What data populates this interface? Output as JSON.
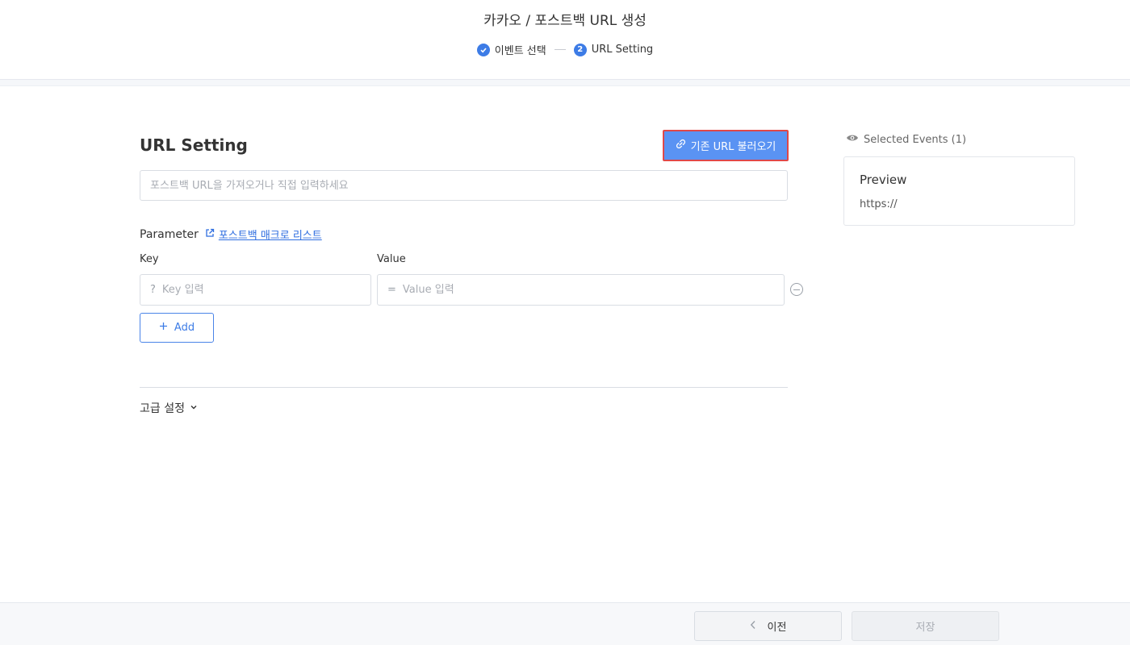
{
  "header": {
    "title": "카카오 / 포스트백 URL 생성",
    "steps": [
      {
        "label": "이벤트 선택",
        "state": "done"
      },
      {
        "number": "2",
        "label": "URL Setting",
        "state": "current"
      }
    ]
  },
  "main": {
    "title": "URL Setting",
    "load_button": "기존 URL 불러오기",
    "url_placeholder": "포스트백 URL을 가져오거나 직접 입력하세요",
    "parameter_label": "Parameter",
    "macro_link": "포스트백 매크로 리스트",
    "key_label": "Key",
    "value_label": "Value",
    "key_prefix": "?",
    "value_prefix": "=",
    "key_placeholder": "Key 입력",
    "value_placeholder": "Value 입력",
    "add_button": "Add",
    "advanced": "고급 설정"
  },
  "side": {
    "selected_events": "Selected Events (1)",
    "preview_title": "Preview",
    "preview_url": "https://"
  },
  "footer": {
    "prev_button": "이전",
    "save_button": "저장"
  },
  "colors": {
    "accent": "#3d7ce6",
    "load_button_bg": "#5a93f3",
    "highlight_border": "#e04848"
  }
}
